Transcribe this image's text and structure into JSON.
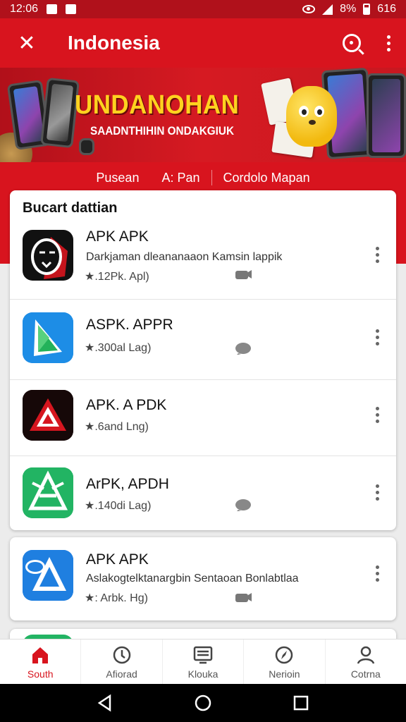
{
  "status_bar": {
    "time": "12:06",
    "battery": "8%",
    "right_time": "616"
  },
  "app_bar": {
    "title": "Indonesia"
  },
  "banner": {
    "headline": "UNDANOHAN",
    "subline": "SAADNTHIHIN ONDAKGIUK"
  },
  "sub_tabs": [
    {
      "label": "Pusean"
    },
    {
      "label": "A: Pan"
    },
    {
      "label": "Cordolo Mapan"
    }
  ],
  "section": {
    "title": "Bucart dattian"
  },
  "apps": [
    {
      "name": "APK APK",
      "description": "Darkjaman dleananaaon Kamsin lappik",
      "meta": "★.12Pk. Apl)",
      "icon": "mask-icon"
    },
    {
      "name": "ASPK. APPR",
      "description": "",
      "meta": "★.300al Lag)",
      "icon": "triangle-play-icon"
    },
    {
      "name": "APK. A PDK",
      "description": "",
      "meta": "★.6and Lng)",
      "icon": "red-a-icon"
    },
    {
      "name": "ArPK, APDH",
      "description": "",
      "meta": "★.140di Lag)",
      "icon": "green-a-icon"
    },
    {
      "name": "APK APK",
      "description": "Aslakogtelktanargbin Sentaoan Bonlabtlaa",
      "meta": "★: Arbk. Hg)",
      "icon": "blue-a-icon"
    }
  ],
  "bottom_nav": [
    {
      "label": "South",
      "icon": "home-icon",
      "active": true
    },
    {
      "label": "Afiorad",
      "icon": "clock-icon",
      "active": false
    },
    {
      "label": "Klouka",
      "icon": "list-icon",
      "active": false
    },
    {
      "label": "Nerioin",
      "icon": "compass-icon",
      "active": false
    },
    {
      "label": "Cotrna",
      "icon": "profile-icon",
      "active": false
    }
  ],
  "colors": {
    "brand_red": "#d8141e",
    "status_red": "#b0111b",
    "banner_yellow": "#ffd21f"
  }
}
